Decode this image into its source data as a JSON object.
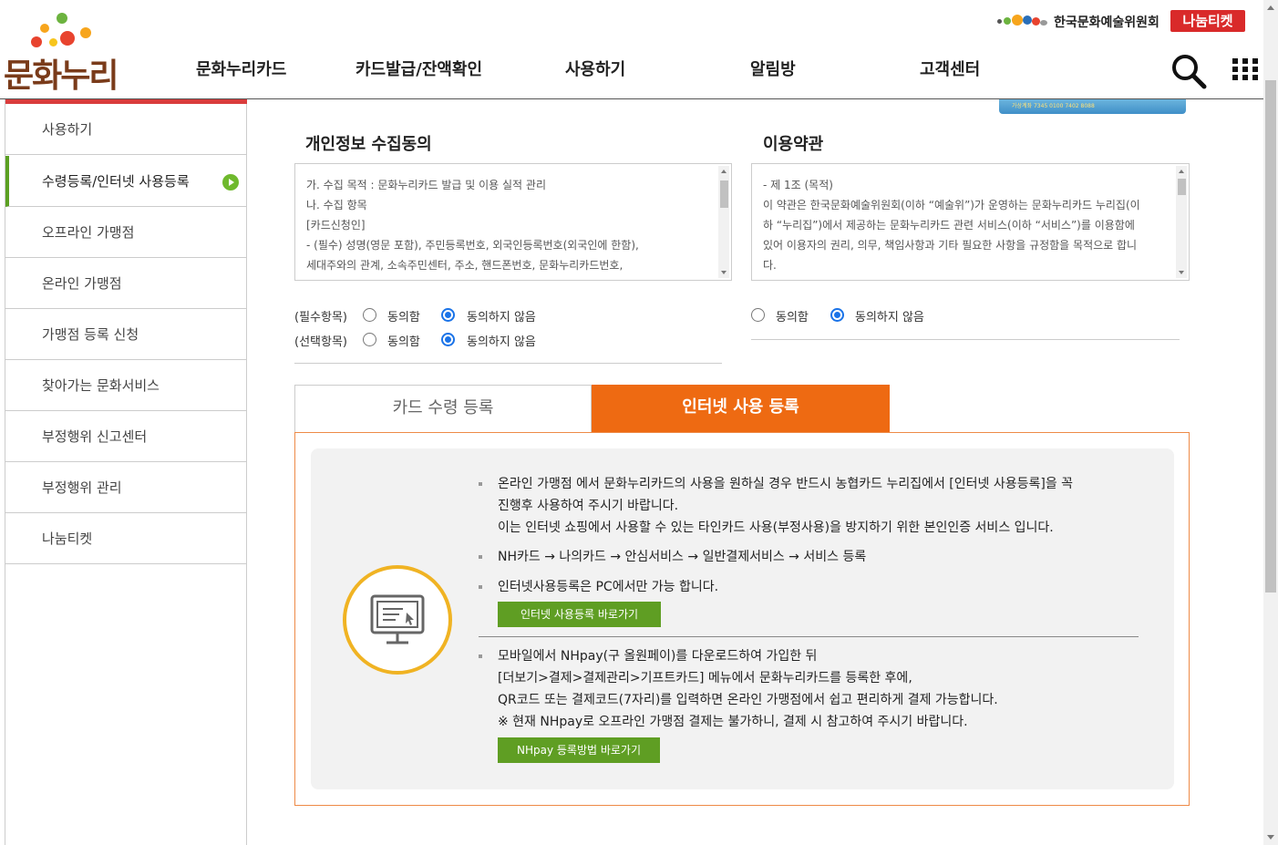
{
  "header": {
    "logo_text": "문화누리",
    "org_name": "한국문화예술위원회",
    "share_ticket_logo": "나눔티켓",
    "gnb": [
      "문화누리카드",
      "카드발급/잔액확인",
      "사용하기",
      "알림방",
      "고객센터"
    ]
  },
  "card_image": {
    "text": "가상계좌  7345 0100 7402 8088"
  },
  "sidebar": {
    "items": [
      {
        "label": "사용하기"
      },
      {
        "label": "수령등록/인터넷 사용등록"
      },
      {
        "label": "오프라인 가맹점"
      },
      {
        "label": "온라인 가맹점"
      },
      {
        "label": "가맹점 등록 신청"
      },
      {
        "label": "찾아가는 문화서비스"
      },
      {
        "label": "부정행위 신고센터"
      },
      {
        "label": "부정행위 관리"
      },
      {
        "label": "나눔티켓"
      }
    ],
    "active_index": 1
  },
  "privacy": {
    "title": "개인정보 수집동의",
    "lines": [
      "가. 수집 목적 : 문화누리카드 발급 및 이용 실적 관리",
      "나. 수집 항목",
      "[카드신청인]",
      "- (필수) 성명(영문 포함), 주민등록번호, 외국인등록번호(외국인에 한함),",
      "세대주와의 관계, 소속주민센터, 주소, 핸드폰번호, 문화누리카드번호,"
    ],
    "required_label": "(필수항목)",
    "optional_label": "(선택항목)",
    "agree": "동의함",
    "disagree": "동의하지 않음"
  },
  "terms": {
    "title": "이용약관",
    "lines": [
      "- 제 1조 (목적)",
      "이 약관은 한국문화예술위원회(이하 “예술위”)가 운영하는 문화누리카드 누리집(이",
      "하 “누리집”)에서 제공하는 문화누리카드 관련 서비스(이하 “서비스”)를 이용함에",
      "있어 이용자의 권리, 의무, 책임사항과 기타 필요한 사항을 규정함을 목적으로 합니",
      "다."
    ],
    "agree": "동의함",
    "disagree": "동의하지 않음"
  },
  "tabs": [
    {
      "label": "카드 수령 등록",
      "active": false
    },
    {
      "label": "인터넷 사용 등록",
      "active": true
    }
  ],
  "panel": {
    "p1_line1": "온라인 가맹점 에서 문화누리카드의 사용을 원하실 경우 반드시 농협카드 누리집에서 [인터넷 사용등록]을 꼭",
    "p1_line2": "진행후 사용하여 주시기 바랍니다.",
    "p1_line3": "이는 인터넷 쇼핑에서 사용할 수 있는 타인카드 사용(부정사용)을 방지하기 위한 본인인증 서비스 입니다.",
    "p2": "NH카드 → 나의카드 → 안심서비스 → 일반결제서비스 → 서비스 등록",
    "p3": "인터넷사용등록은 PC에서만 가능 합니다.",
    "btn1": "인터넷 사용등록 바로가기",
    "p4_line1": "모바일에서 NHpay(구 올원페이)를 다운로드하여 가입한 뒤",
    "p4_line2": "[더보기>결제>결제관리>기프트카드] 메뉴에서 문화누리카드를 등록한 후에,",
    "p4_line3": "QR코드 또는 결제코드(7자리)를 입력하면 온라인 가맹점에서 쉽고 편리하게 결제 가능합니다.",
    "p4_line4": "※ 현재 NHpay로 오프라인 가맹점 결제는 불가하니, 결제 시 참고하여 주시기 바랍니다.",
    "btn2": "NHpay 등록방법 바로가기"
  },
  "colors": {
    "tab_active": "#ee6a12",
    "button_green": "#5f9e23",
    "icon_ring": "#f0b323",
    "sidebar_accent": "#6fb92d"
  }
}
